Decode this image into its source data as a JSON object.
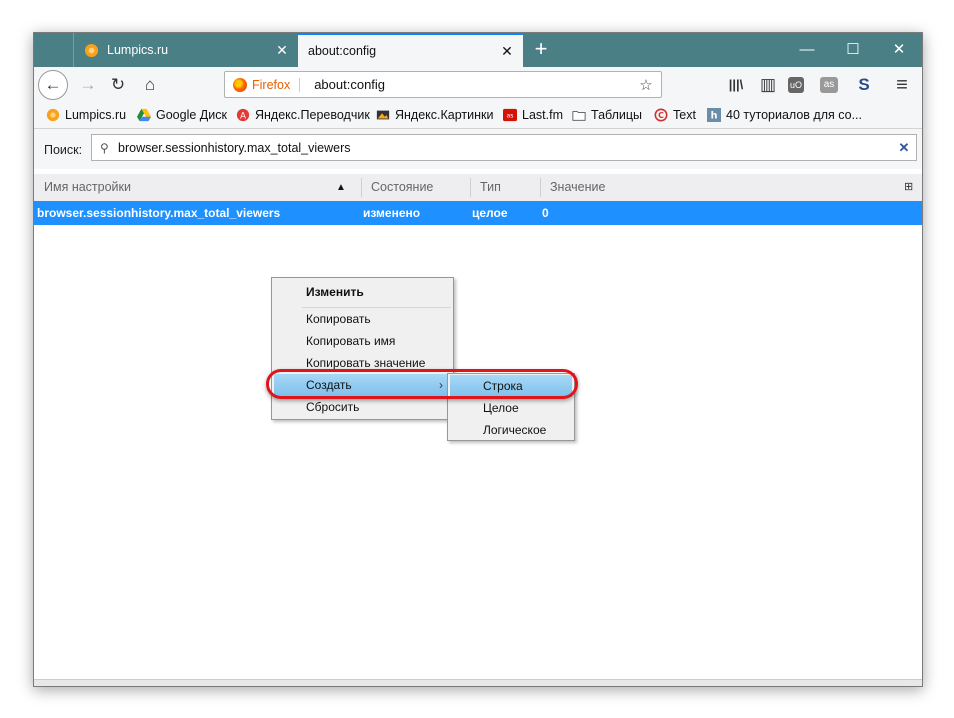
{
  "tabs": [
    {
      "title": "Lumpics.ru",
      "close": "✕"
    },
    {
      "title": "about:config",
      "close": "✕"
    }
  ],
  "newtab": "+",
  "window_controls": {
    "minimize": "—",
    "maximize": "☐",
    "close": "✕"
  },
  "nav": {
    "back": "←",
    "forward": "→",
    "reload": "↻",
    "home": "⌂",
    "identity_label": "Firefox",
    "url": "about:config",
    "bookmark_star": "☆",
    "right_icons": {
      "library": "|||\\",
      "sidebar": "▥",
      "ublock": "uO",
      "lastfm": "as",
      "stylish": "S",
      "menu": "≡"
    }
  },
  "bookmarks": [
    {
      "label": "Lumpics.ru",
      "icon": "lumpics-icon"
    },
    {
      "label": "Google Диск",
      "icon": "google-drive-icon"
    },
    {
      "label": "Яндекс.Переводчик",
      "icon": "yandex-translate-icon"
    },
    {
      "label": "Яндекс.Картинки",
      "icon": "yandex-images-icon"
    },
    {
      "label": "Last.fm",
      "icon": "lastfm-icon"
    },
    {
      "label": "Таблицы",
      "icon": "folder-icon"
    },
    {
      "label": "Text",
      "icon": "copyright-icon"
    },
    {
      "label": "40 туториалов для со...",
      "icon": "h-icon"
    }
  ],
  "search": {
    "label": "Поиск:",
    "value": "browser.sessionhistory.max_total_viewers",
    "clear": "✕"
  },
  "columns": {
    "name": "Имя настройки",
    "sort": "▲",
    "status": "Состояние",
    "type": "Тип",
    "value": "Значение",
    "picker": "⊞"
  },
  "rows": [
    {
      "name": "browser.sessionhistory.max_total_viewers",
      "status": "изменено",
      "type": "целое",
      "value": "0"
    }
  ],
  "context_menu": [
    {
      "label": "Изменить",
      "bold": true
    },
    {
      "label": "Копировать"
    },
    {
      "label": "Копировать имя"
    },
    {
      "label": "Копировать значение"
    },
    {
      "label": "Создать",
      "submenu": true,
      "highlighted": true,
      "arrow": "›"
    },
    {
      "label": "Сбросить"
    }
  ],
  "submenu": [
    {
      "label": "Строка",
      "highlighted": true
    },
    {
      "label": "Целое"
    },
    {
      "label": "Логическое"
    }
  ],
  "colors": {
    "tabbar": "#4a7f86",
    "selection": "#1e90ff",
    "highlight_oval": "#e0151b",
    "active_tab_accent": "#0a84ff"
  }
}
